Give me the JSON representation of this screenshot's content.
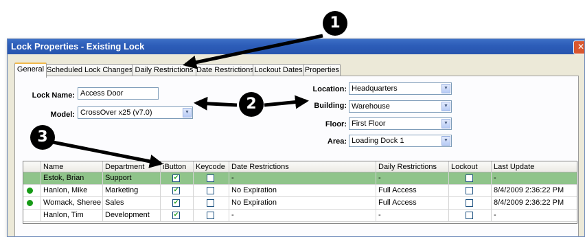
{
  "window": {
    "title": "Lock Properties - Existing Lock",
    "close_glyph": "✕"
  },
  "tabs": [
    "General",
    "Scheduled Lock Changes",
    "Daily Restrictions",
    "Date Restrictions",
    "Lockout Dates",
    "Properties"
  ],
  "form": {
    "lock_name_label": "Lock Name:",
    "lock_name_value": "Access Door",
    "model_label": "Model:",
    "model_value": "CrossOver x25 (v7.0)",
    "location_label": "Location:",
    "location_value": "Headquarters",
    "building_label": "Building:",
    "building_value": "Warehouse",
    "floor_label": "Floor:",
    "floor_value": "First Floor",
    "area_label": "Area:",
    "area_value": "Loading Dock 1"
  },
  "grid": {
    "headers": [
      "Name",
      "Department",
      "iButton",
      "Keycode",
      "Date Restrictions",
      "Daily Restrictions",
      "Lockout",
      "Last Update"
    ],
    "rows": [
      {
        "status": "",
        "name": "Estok, Brian",
        "department": "Support",
        "ibutton": true,
        "keycode": false,
        "date_restrictions": "-",
        "daily_restrictions": "-",
        "lockout": false,
        "last_update": "-"
      },
      {
        "status": "active",
        "name": "Hanlon, Mike",
        "department": "Marketing",
        "ibutton": true,
        "keycode": false,
        "date_restrictions": "No Expiration",
        "daily_restrictions": "Full Access",
        "lockout": false,
        "last_update": "8/4/2009 2:36:22 PM"
      },
      {
        "status": "active",
        "name": "Womack, Sheree",
        "department": "Sales",
        "ibutton": true,
        "keycode": false,
        "date_restrictions": "No Expiration",
        "daily_restrictions": "Full Access",
        "lockout": false,
        "last_update": "8/4/2009 2:36:22 PM"
      },
      {
        "status": "",
        "name": "Hanlon, Tim",
        "department": "Development",
        "ibutton": true,
        "keycode": false,
        "date_restrictions": "-",
        "daily_restrictions": "-",
        "lockout": false,
        "last_update": "-"
      }
    ]
  },
  "callouts": [
    "1",
    "2",
    "3"
  ],
  "colors": {
    "title_bar": "#2c5cb8",
    "selected_row": "#8fc48a",
    "status_dot": "#169a16",
    "callout": "#000000"
  },
  "icons": {
    "dropdown": "chevron-down-icon",
    "check": "checkmark-icon",
    "status": "status-dot-icon",
    "close": "close-icon"
  }
}
